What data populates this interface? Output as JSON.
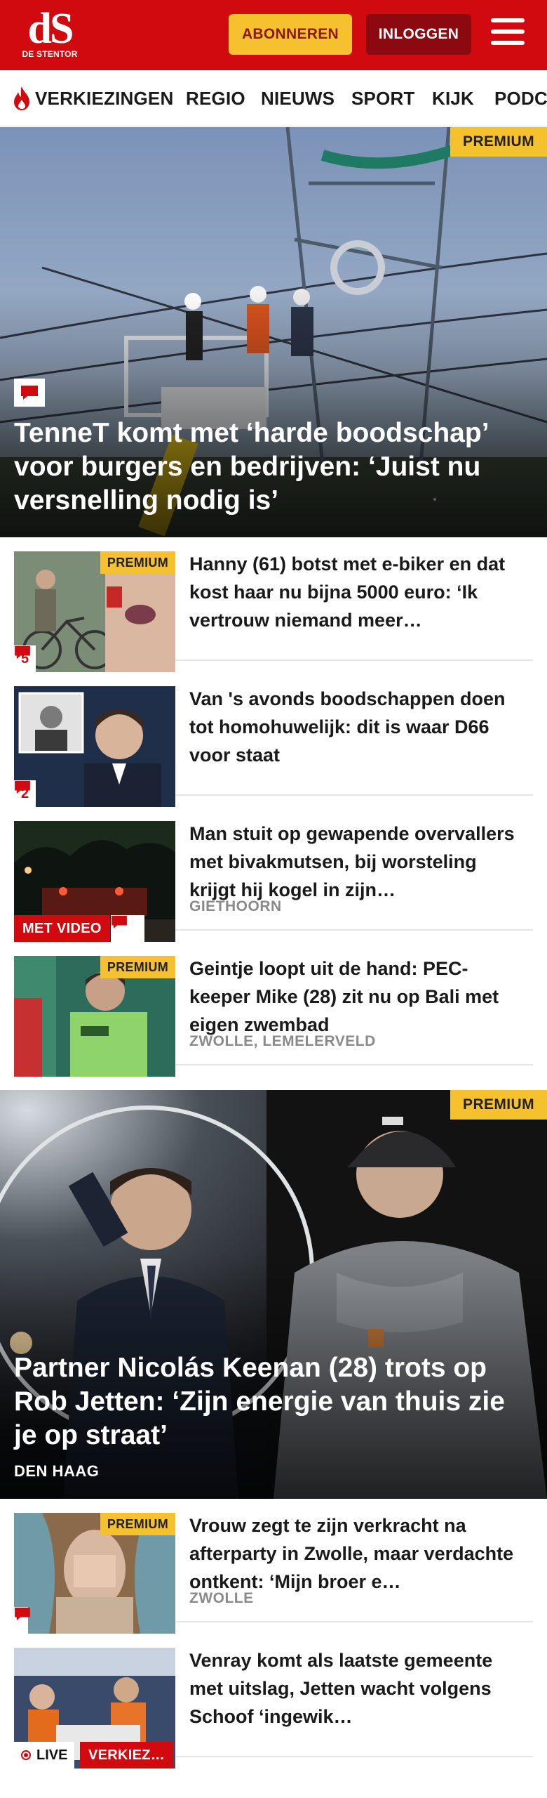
{
  "header": {
    "logo_mark": "dS",
    "logo_sub": "DE STENTOR",
    "subscribe_label": "ABONNEREN",
    "login_label": "INLOGGEN",
    "menu_icon": "hamburger-menu-icon",
    "brand_color": "#d10a10",
    "accent_color": "#f5c12e"
  },
  "nav": {
    "items": [
      {
        "label": "VERKIEZINGEN",
        "icon": "flame-icon"
      },
      {
        "label": "REGIO"
      },
      {
        "label": "NIEUWS"
      },
      {
        "label": "SPORT"
      },
      {
        "label": "KIJK"
      },
      {
        "label": "PODC"
      }
    ]
  },
  "hero1": {
    "badge": "PREMIUM",
    "title": "TenneT komt met ‘harde boodschap’ voor burgers en bedrijven: ‘Juist nu versnelling nodig is’",
    "comment_icon": "comment-icon"
  },
  "articles": [
    {
      "badge": "PREMIUM",
      "comments": "5",
      "title": "Hanny (61) botst met e-biker en dat kost haar nu bijna 5000 euro: ‘Ik vertrouw niemand meer…"
    },
    {
      "comments": "2",
      "title": "Van 's avonds boodschappen doen tot homohuwelijk: dit is waar D66 voor staat"
    },
    {
      "video_label": "MET VIDEO",
      "title": "Man stuit op gewapende overval­lers met bivakmutsen, bij worsteling krijgt hij kogel in zijn…",
      "location": "GIETHOORN"
    },
    {
      "badge": "PREMIUM",
      "title": "Geintje loopt uit de hand: PEC-keeper Mike (28) zit nu op Bali met eigen zwembad",
      "location": "ZWOLLE, LEMELERVELD"
    }
  ],
  "hero2": {
    "badge": "PREMIUM",
    "title": "Partner Nicolás Keenan (28) trots op Rob Jetten: ‘Zijn energie van thuis zie je op straat’",
    "location": "DEN HAAG"
  },
  "articles2": [
    {
      "badge": "PREMIUM",
      "title": "Vrouw zegt te zijn verkracht na afterparty in Zwolle, maar verdachte ontkent: ‘Mijn broer e…",
      "location": "ZWOLLE"
    },
    {
      "live_label": "LIVE",
      "tag_label": "VERKIEZ…",
      "title": "Venray komt als laatste gemeente met uitslag, Jetten wacht volgens Schoof ‘ingewik­…"
    }
  ]
}
